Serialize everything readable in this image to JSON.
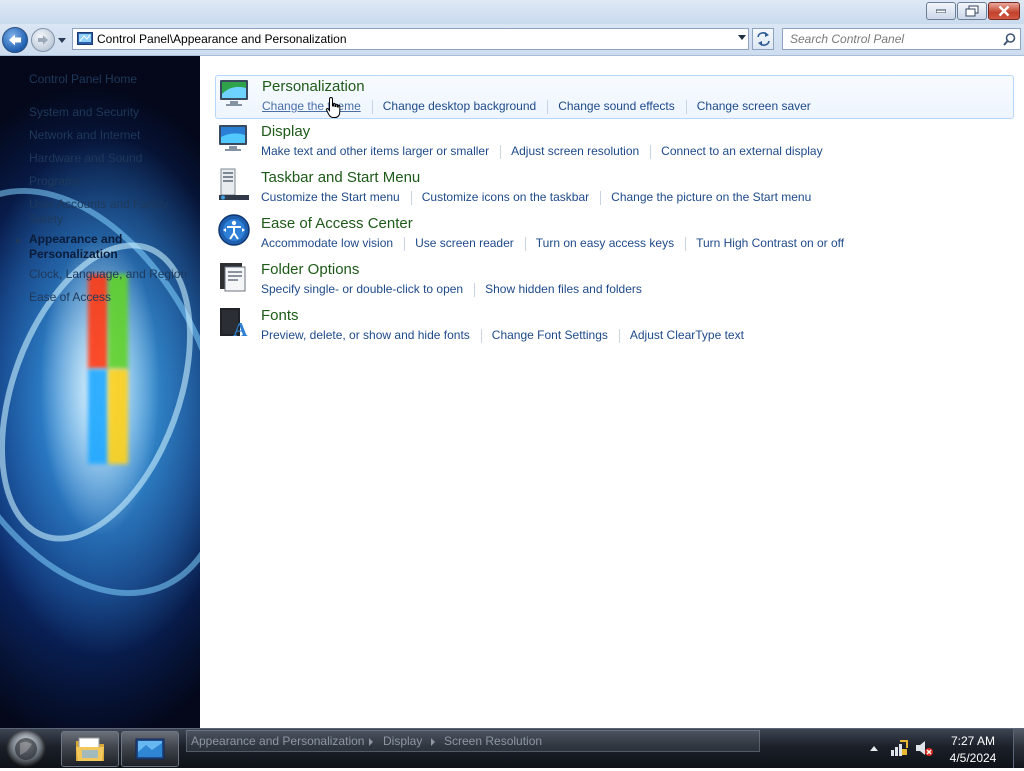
{
  "window": {
    "minimize_icon": "minimize-icon",
    "maximize_icon": "restore-icon",
    "close_icon": "close-icon"
  },
  "navigation": {
    "back_icon": "back-arrow-icon",
    "forward_icon": "forward-arrow-icon",
    "recent_icon": "chevron-down-icon",
    "address": "Control Panel\\Appearance and Personalization",
    "refresh_icon": "refresh-icon",
    "search_placeholder": "Search Control Panel"
  },
  "sidebar": {
    "items": [
      {
        "label": "Control Panel Home",
        "selected": false
      },
      {
        "label": "System and Security",
        "selected": false
      },
      {
        "label": "Network and Internet",
        "selected": false
      },
      {
        "label": "Hardware and Sound",
        "selected": false
      },
      {
        "label": "Programs",
        "selected": false
      },
      {
        "label": "User Accounts and Family Safety",
        "selected": false
      },
      {
        "label": "Appearance and Personalization",
        "selected": true
      },
      {
        "label": "Clock, Language, and Region",
        "selected": false
      },
      {
        "label": "Ease of Access",
        "selected": false
      }
    ]
  },
  "categories": [
    {
      "title": "Personalization",
      "icon": "personalization-icon",
      "links": [
        "Change the theme",
        "Change desktop background",
        "Change sound effects",
        "Change screen saver"
      ]
    },
    {
      "title": "Display",
      "icon": "display-icon",
      "links": [
        "Make text and other items larger or smaller",
        "Adjust screen resolution",
        "Connect to an external display"
      ]
    },
    {
      "title": "Taskbar and Start Menu",
      "icon": "taskbar-icon",
      "links": [
        "Customize the Start menu",
        "Customize icons on the taskbar",
        "Change the picture on the Start menu"
      ]
    },
    {
      "title": "Ease of Access Center",
      "icon": "ease-of-access-icon",
      "links": [
        "Accommodate low vision",
        "Use screen reader",
        "Turn on easy access keys",
        "Turn High Contrast on or off"
      ]
    },
    {
      "title": "Folder Options",
      "icon": "folder-options-icon",
      "links": [
        "Specify single- or double-click to open",
        "Show hidden files and folders"
      ]
    },
    {
      "title": "Fonts",
      "icon": "fonts-icon",
      "links": [
        "Preview, delete, or show and hide fonts",
        "Change Font Settings",
        "Adjust ClearType text"
      ]
    }
  ],
  "taskbar": {
    "start_icon": "start-orb-icon",
    "pinned": [
      "explorer-icon",
      "control-panel-icon"
    ],
    "preview_breadcrumb": [
      "Appearance and Personalization",
      "Display",
      "Screen Resolution"
    ],
    "tray": {
      "show_hidden_icon": "chevron-up-icon",
      "network_icon": "network-icon",
      "volume_icon": "volume-muted-icon"
    },
    "clock": {
      "time": "7:27 AM",
      "date": "4/5/2024"
    }
  },
  "colors": {
    "category_title": "#1e5a18",
    "link": "#1e4a8a",
    "hover_border": "#b8d6fb"
  }
}
